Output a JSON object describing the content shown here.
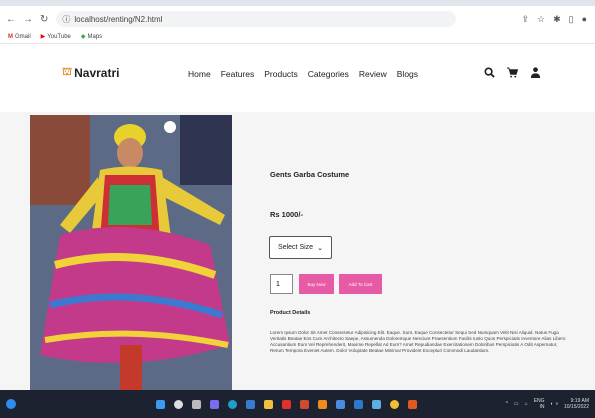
{
  "browser": {
    "url": "localhost/renting/N2.html",
    "bookmarks": [
      "Gmail",
      "YouTube",
      "Maps"
    ]
  },
  "header": {
    "brand": "Navratri",
    "menu": [
      "Home",
      "Features",
      "Products",
      "Categories",
      "Review",
      "Blogs"
    ]
  },
  "product": {
    "title": "Gents Garba Costume",
    "price": "Rs 1000/-",
    "size_select": "Select Size",
    "quantity": "1",
    "buy_now": "Buy Now",
    "add_to_cart": "Add To Cart",
    "details_label": "Product Details",
    "details_text": "Lorem Ipsum Dolor Sit Amet Consectetur Adipisicing Elit. Eaque. Sunt. Eaque Consectetur Sequi Sed Numquam Velit Nisi Aliquid. Natus Fuga Veritatis Beatae Eos Cum Architecto Saepe, Assumenda Doloremque Nesciunt Praesentium Facilis Iusto Quos Perspiciatis Inventore Alias Libero Accusantium Eum Vel Reprehenderit, Maxime Repellat Ad Eum? Amet Repudiandae Exercitationem Doloribus Perspiciatis A Odit Aspernatur, Rerum Tempora Eveniet Autem. Dolor Voluptate Beatae Minima! Provident Excepturi Commodi Laudantium."
  },
  "taskbar": {
    "lang": "ENG",
    "region": "IN",
    "time": "9:19 AM",
    "date": "10/15/2022"
  }
}
